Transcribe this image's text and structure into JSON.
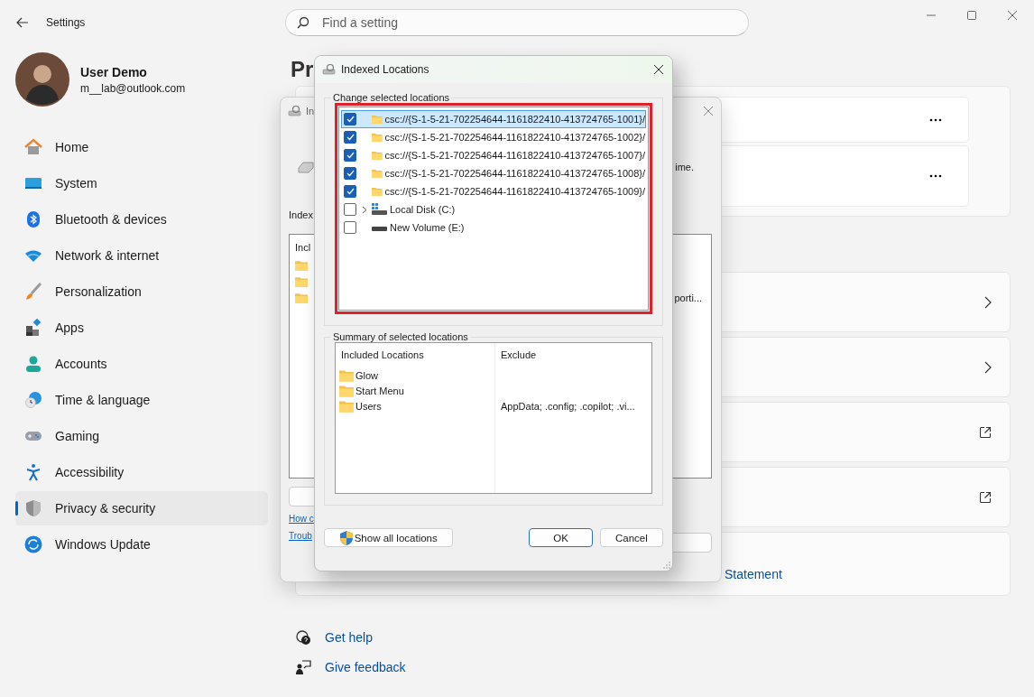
{
  "window": {
    "title": "Settings"
  },
  "search": {
    "placeholder": "Find a setting"
  },
  "profile": {
    "name": "User Demo",
    "email": "m__lab@outlook.com"
  },
  "sidebar": {
    "items": [
      {
        "kind": "home",
        "label": "Home",
        "selected": false
      },
      {
        "kind": "system",
        "label": "System",
        "selected": false
      },
      {
        "kind": "bluetooth",
        "label": "Bluetooth & devices",
        "selected": false
      },
      {
        "kind": "network",
        "label": "Network & internet",
        "selected": false
      },
      {
        "kind": "personalization",
        "label": "Personalization",
        "selected": false
      },
      {
        "kind": "apps",
        "label": "Apps",
        "selected": false
      },
      {
        "kind": "accounts",
        "label": "Accounts",
        "selected": false
      },
      {
        "kind": "time",
        "label": "Time & language",
        "selected": false
      },
      {
        "kind": "gaming",
        "label": "Gaming",
        "selected": false
      },
      {
        "kind": "accessibility",
        "label": "Accessibility",
        "selected": false
      },
      {
        "kind": "privacy",
        "label": "Privacy & security",
        "selected": true
      },
      {
        "kind": "update",
        "label": "Windows Update",
        "selected": false
      }
    ]
  },
  "page": {
    "heading": "Pr",
    "group_cards": [
      {
        "kind": "more"
      },
      {
        "kind": "more"
      }
    ],
    "cards": [
      {
        "kind": "chevron"
      },
      {
        "kind": "chevron"
      },
      {
        "kind": "external"
      },
      {
        "kind": "external"
      },
      {
        "kind": "link",
        "text": "Statement"
      }
    ],
    "help_links": [
      {
        "kind": "help",
        "label": "Get help"
      },
      {
        "kind": "feedback",
        "label": "Give feedback"
      }
    ]
  },
  "back_dialog": {
    "title": "In",
    "status_text": "ime.",
    "label": "Index",
    "list_header": "Incl",
    "list_rows": [
      {
        "text": ""
      },
      {
        "text": ""
      },
      {
        "text": "porti..."
      }
    ],
    "links": [
      "How c",
      "Troub"
    ]
  },
  "dialog": {
    "title": "Indexed Locations",
    "change_group": {
      "legend": "Change selected locations",
      "highlight": true,
      "items": [
        {
          "kind": "folder",
          "label": "csc://{S-1-5-21-702254644-1161822410-413724765-1001}/",
          "checked": true,
          "selected": true,
          "expandable": false
        },
        {
          "kind": "folder",
          "label": "csc://{S-1-5-21-702254644-1161822410-413724765-1002}/",
          "checked": true,
          "selected": false,
          "expandable": false
        },
        {
          "kind": "folder",
          "label": "csc://{S-1-5-21-702254644-1161822410-413724765-1007}/",
          "checked": true,
          "selected": false,
          "expandable": false
        },
        {
          "kind": "folder",
          "label": "csc://{S-1-5-21-702254644-1161822410-413724765-1008}/",
          "checked": true,
          "selected": false,
          "expandable": false
        },
        {
          "kind": "folder",
          "label": "csc://{S-1-5-21-702254644-1161822410-413724765-1009}/",
          "checked": true,
          "selected": false,
          "expandable": false
        },
        {
          "kind": "system-drive",
          "label": "Local Disk (C:)",
          "checked": false,
          "selected": false,
          "expandable": true
        },
        {
          "kind": "drive",
          "label": "New Volume (E:)",
          "checked": false,
          "selected": false,
          "expandable": false
        }
      ]
    },
    "summary_group": {
      "legend": "Summary of selected locations",
      "columns": [
        "Included Locations",
        "Exclude"
      ],
      "rows": [
        {
          "location": "Glow"
        },
        {
          "location": "Start Menu"
        },
        {
          "location": "Users",
          "exclude": "AppData; .config; .copilot; .vi..."
        }
      ]
    },
    "buttons": [
      {
        "kind": "shield",
        "label": "Show all locations"
      },
      {
        "kind": "default",
        "label": "OK"
      },
      {
        "kind": "normal",
        "label": "Cancel"
      }
    ]
  }
}
